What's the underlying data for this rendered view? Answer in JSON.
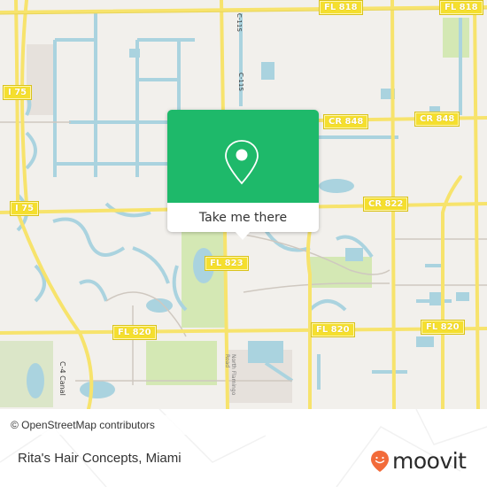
{
  "popup": {
    "button_label": "Take me there",
    "icon": "location-pin-icon",
    "color": "#1eb96a"
  },
  "map": {
    "attribution": "© OpenStreetMap contributors",
    "road_labels": [
      {
        "id": "fl818-a",
        "text": "FL 818"
      },
      {
        "id": "fl818-b",
        "text": "FL 818"
      },
      {
        "id": "i75-a",
        "text": "I 75"
      },
      {
        "id": "i75-b",
        "text": "I 75"
      },
      {
        "id": "cr848-a",
        "text": "CR 848"
      },
      {
        "id": "cr848-b",
        "text": "CR 848"
      },
      {
        "id": "cr822",
        "text": "CR 822"
      },
      {
        "id": "fl823",
        "text": "FL 823"
      },
      {
        "id": "fl820-a",
        "text": "FL 820"
      },
      {
        "id": "fl820-b",
        "text": "FL 820"
      },
      {
        "id": "fl820-c",
        "text": "FL 820"
      }
    ],
    "canal_labels": [
      {
        "id": "c11s-a",
        "text": "C-11S"
      },
      {
        "id": "c11s-b",
        "text": "C-11S"
      },
      {
        "id": "c4",
        "text": "C-4 Canal"
      },
      {
        "id": "nw-street",
        "text": "North Flamingo Road"
      }
    ],
    "colors": {
      "land": "#f2f0ec",
      "water": "#aad3df",
      "road": "#f7e36c",
      "park": "#d4e8b4"
    }
  },
  "footer": {
    "place_name": "Rita's Hair Concepts, Miami",
    "brand": "moovit",
    "brand_color": "#f26b3a"
  }
}
